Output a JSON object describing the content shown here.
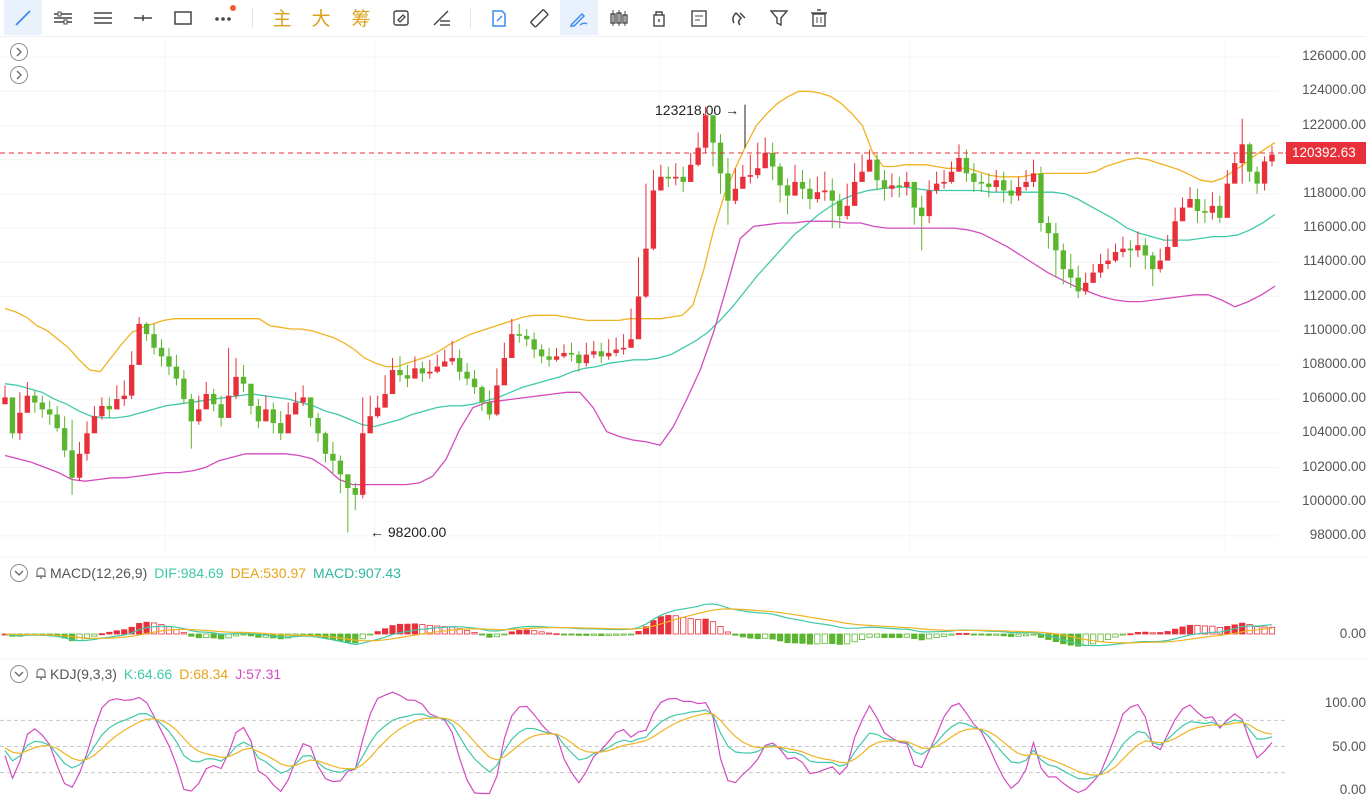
{
  "toolbar": {
    "items": [
      {
        "name": "trend-line-tool",
        "icon": "trend-line-icon",
        "active": true
      },
      {
        "name": "horizontal-ray-tool",
        "icon": "horizontal-ray-icon"
      },
      {
        "name": "parallel-channel-tool",
        "icon": "parallel-lines-icon"
      },
      {
        "name": "horizontal-line-tool",
        "icon": "horizontal-line-icon"
      },
      {
        "name": "rectangle-tool",
        "icon": "rectangle-icon"
      },
      {
        "name": "more-tools",
        "icon": "more-dots-icon"
      }
    ],
    "text_buttons": [
      "主",
      "大",
      "筹"
    ],
    "tools_right": [
      {
        "name": "auto-refresh",
        "icon": "refresh-edit-icon"
      },
      {
        "name": "compare",
        "icon": "compare-icon"
      },
      {
        "name": "copy",
        "icon": "copy-icon"
      },
      {
        "name": "ruler",
        "icon": "ruler-icon"
      },
      {
        "name": "draw",
        "icon": "pen-icon",
        "active": true
      },
      {
        "name": "candles",
        "icon": "candles-icon"
      },
      {
        "name": "lock",
        "icon": "lock-icon"
      },
      {
        "name": "note",
        "icon": "note-icon"
      },
      {
        "name": "magnet",
        "icon": "magnet-icon"
      },
      {
        "name": "filter",
        "icon": "filter-icon"
      },
      {
        "name": "delete",
        "icon": "trash-icon"
      }
    ]
  },
  "colors": {
    "up": "#e8303a",
    "down": "#5bb52f",
    "boll_upper": "#f0b323",
    "boll_mid": "#3fc9a8",
    "boll_lower": "#d44bbf",
    "dif": "#3fc9a8",
    "dea": "#f0b323",
    "k": "#3fc9a8",
    "d": "#f0b323",
    "j": "#d44bbf",
    "price_line": "#e8303a"
  },
  "main_axis": {
    "ticks": [
      "126000.00",
      "124000.00",
      "122000.00",
      "120000.00",
      "118000.00",
      "116000.00",
      "114000.00",
      "112000.00",
      "110000.00",
      "108000.00",
      "106000.00",
      "104000.00",
      "102000.00",
      "100000.00",
      "98000.00"
    ],
    "current_price": "120392.63",
    "current_value": 120392.63
  },
  "annotations": {
    "high": "123218.00 →",
    "low": "← 98200.00"
  },
  "macd": {
    "label": "MACD(12,26,9)",
    "dif": "DIF:984.69",
    "dea": "DEA:530.97",
    "macd": "MACD:907.43",
    "zero_tick": "0.00"
  },
  "kdj": {
    "label": "KDJ(9,3,3)",
    "k": "K:64.66",
    "d": "D:68.34",
    "j": "J:57.31",
    "ticks": [
      "100.00",
      "50.00",
      "0.00"
    ]
  },
  "chart_data": {
    "type": "candlestick",
    "y_range": [
      97000,
      127000
    ],
    "closes": [
      106100,
      104000,
      105200,
      106200,
      105800,
      105400,
      105100,
      104300,
      103000,
      101400,
      102800,
      104000,
      105000,
      105600,
      105400,
      106000,
      106200,
      108000,
      110400,
      109800,
      109000,
      108500,
      107900,
      107200,
      106000,
      104700,
      105400,
      106300,
      105700,
      104900,
      106200,
      107300,
      106900,
      105600,
      104700,
      105400,
      104600,
      104000,
      105100,
      105800,
      106100,
      104900,
      104000,
      102800,
      102400,
      101600,
      100800,
      100400,
      104000,
      105000,
      105500,
      106300,
      107700,
      107400,
      107200,
      107800,
      107500,
      107600,
      107900,
      108200,
      108400,
      107600,
      107200,
      106700,
      105800,
      105100,
      106800,
      108400,
      109800,
      109700,
      109500,
      108900,
      108500,
      108300,
      108500,
      108700,
      108600,
      108100,
      108600,
      108800,
      108500,
      108700,
      108900,
      109000,
      109500,
      112000,
      114800,
      118200,
      119000,
      118900,
      119000,
      118700,
      119700,
      120700,
      122600,
      121000,
      119200,
      117600,
      118300,
      119000,
      119100,
      119500,
      120400,
      119600,
      118500,
      117900,
      118700,
      118300,
      117700,
      118100,
      118200,
      117600,
      116700,
      117300,
      118700,
      119300,
      120000,
      118800,
      118300,
      118500,
      118400,
      118700,
      117200,
      116700,
      118200,
      118600,
      118700,
      119300,
      120100,
      119200,
      118700,
      118600,
      118400,
      118800,
      118200,
      117900,
      118400,
      118700,
      119200,
      116300,
      115700,
      114700,
      113600,
      113100,
      112300,
      112800,
      113400,
      113900,
      114100,
      114600,
      114800,
      114700,
      115000,
      114400,
      113600,
      114100,
      114900,
      116400,
      117200,
      117700,
      117000,
      116900,
      117300,
      116600,
      118600,
      119800,
      120900,
      119300,
      118600,
      119900,
      120300
    ],
    "highs": [
      106800,
      106000,
      106400,
      107000,
      106500,
      106200,
      105900,
      105600,
      105000,
      104800,
      103500,
      104700,
      105600,
      106100,
      106100,
      106800,
      107100,
      108800,
      110800,
      110500,
      110400,
      109500,
      109000,
      108600,
      107700,
      106300,
      106200,
      107000,
      106600,
      106200,
      109000,
      108400,
      108000,
      106700,
      106000,
      106200,
      105800,
      105300,
      105800,
      106400,
      106800,
      106100,
      105200,
      104100,
      103500,
      102700,
      101500,
      101100,
      106100,
      106200,
      106200,
      107400,
      108400,
      108500,
      108000,
      108500,
      108200,
      108300,
      108600,
      108900,
      109400,
      108900,
      108100,
      107700,
      106800,
      106500,
      107800,
      109300,
      110700,
      110400,
      110100,
      109900,
      109200,
      109000,
      109000,
      109200,
      109300,
      108800,
      109300,
      109400,
      109300,
      109500,
      109600,
      109800,
      111300,
      114300,
      118600,
      119400,
      119700,
      119600,
      119800,
      119600,
      120400,
      121600,
      123100,
      122500,
      121500,
      120100,
      119500,
      119700,
      120300,
      121000,
      121300,
      121000,
      119800,
      118900,
      119700,
      119400,
      118900,
      119000,
      119300,
      118900,
      118000,
      118600,
      119800,
      120300,
      120600,
      120300,
      119400,
      119200,
      119000,
      119300,
      118700,
      117900,
      118800,
      119300,
      119400,
      119900,
      120900,
      120600,
      119800,
      119200,
      119200,
      119400,
      119300,
      118800,
      119000,
      119400,
      120000,
      119600,
      116700,
      116300,
      115100,
      114500,
      113800,
      113400,
      113900,
      114500,
      114800,
      115100,
      115500,
      115300,
      115800,
      115400,
      114600,
      114800,
      115600,
      117200,
      117800,
      118400,
      118300,
      117700,
      118100,
      117900,
      119400,
      120400,
      122400,
      121000,
      119600,
      120200,
      120800
    ],
    "lows": [
      105700,
      103700,
      103600,
      105300,
      105200,
      104900,
      104500,
      104100,
      102600,
      100400,
      101200,
      102400,
      104200,
      104800,
      104900,
      105500,
      105600,
      106000,
      108000,
      109400,
      108600,
      107900,
      107400,
      106800,
      105700,
      103100,
      104500,
      105500,
      105300,
      104400,
      105300,
      106000,
      106400,
      105100,
      104300,
      104800,
      104000,
      103600,
      104400,
      105300,
      105600,
      104400,
      103500,
      102300,
      101600,
      100500,
      98200,
      99500,
      100200,
      104400,
      104900,
      105600,
      107200,
      107000,
      106700,
      107300,
      107000,
      107200,
      107500,
      107900,
      108000,
      107100,
      106800,
      106300,
      105300,
      104800,
      105000,
      107900,
      109300,
      109300,
      109100,
      108400,
      108100,
      107900,
      108200,
      108400,
      108200,
      107600,
      107900,
      108400,
      108100,
      108300,
      108500,
      108600,
      109100,
      110900,
      111900,
      114700,
      118400,
      118400,
      118500,
      118100,
      118900,
      119600,
      120400,
      119600,
      118000,
      116200,
      117400,
      118500,
      118600,
      118900,
      119600,
      118800,
      117500,
      116800,
      117900,
      117700,
      117100,
      117500,
      117600,
      116000,
      116000,
      116500,
      117900,
      118800,
      119400,
      118200,
      117600,
      117800,
      117800,
      117900,
      116200,
      114700,
      116300,
      118000,
      118300,
      118600,
      119300,
      118700,
      118100,
      118100,
      117800,
      118100,
      117500,
      117400,
      117600,
      118200,
      118400,
      115800,
      114800,
      113100,
      112700,
      112500,
      111900,
      112100,
      112800,
      113100,
      113600,
      114000,
      114300,
      113700,
      114300,
      113600,
      112600,
      113400,
      114300,
      115600,
      116500,
      117200,
      116300,
      116300,
      116500,
      116300,
      118000,
      119300,
      118600,
      118700,
      118000,
      118200,
      119600
    ],
    "boll_upper": [
      111300,
      111100,
      110800,
      110300,
      110000,
      109500,
      109000,
      108300,
      107700,
      107600,
      108400,
      109200,
      109900,
      110200,
      110400,
      110600,
      110700,
      110700,
      110700,
      110700,
      110700,
      110700,
      110700,
      110700,
      110700,
      110300,
      110200,
      110100,
      110100,
      110000,
      109800,
      109600,
      109300,
      108900,
      108400,
      108100,
      107900,
      107900,
      108100,
      108300,
      108500,
      108800,
      109200,
      109500,
      109800,
      110000,
      110200,
      110400,
      110600,
      110800,
      110900,
      110900,
      110900,
      110800,
      110700,
      110600,
      110600,
      110600,
      110600,
      110700,
      110700,
      110700,
      110700,
      110800,
      110900,
      111500,
      113500,
      116000,
      118000,
      119500,
      120800,
      122000,
      122700,
      123300,
      123700,
      124000,
      124000,
      123900,
      123700,
      123300,
      122700,
      122000,
      120400,
      119600,
      119600,
      119700,
      119700,
      119700,
      119600,
      119500,
      119500,
      119500,
      119300,
      119100,
      119000,
      119000,
      119000,
      119100,
      119200,
      119200,
      119200,
      119200,
      119200,
      119300,
      119600,
      119800,
      120000,
      120100,
      120000,
      119800,
      119600,
      119400,
      119100,
      118800,
      118700,
      118900,
      119300,
      119700,
      120200,
      120600,
      121000
    ],
    "boll_mid": [
      106900,
      106800,
      106600,
      106400,
      106000,
      105700,
      105300,
      105000,
      104900,
      104900,
      105000,
      105200,
      105400,
      105600,
      105700,
      105800,
      105900,
      106000,
      106100,
      106200,
      106300,
      106200,
      106100,
      106000,
      105800,
      105600,
      105300,
      105100,
      104800,
      104500,
      104400,
      104600,
      104800,
      105100,
      105300,
      105500,
      105600,
      105600,
      105700,
      105900,
      106100,
      106400,
      106700,
      106900,
      107100,
      107300,
      107600,
      107800,
      107900,
      108100,
      108200,
      108300,
      108300,
      108400,
      108600,
      109000,
      109400,
      109900,
      110600,
      111400,
      112300,
      113200,
      114000,
      114800,
      115600,
      116200,
      116800,
      117300,
      117700,
      118000,
      118200,
      118300,
      118400,
      118400,
      118300,
      118200,
      118200,
      118200,
      118200,
      118200,
      118100,
      118100,
      118100,
      118100,
      118100,
      118100,
      118000,
      117700,
      117300,
      116900,
      116500,
      116000,
      115700,
      115500,
      115300,
      115300,
      115300,
      115400,
      115500,
      115500,
      115600,
      115900,
      116300,
      116800
    ],
    "boll_lower": [
      102700,
      102500,
      102300,
      102000,
      101700,
      101300,
      101200,
      101300,
      101400,
      101400,
      101500,
      101600,
      101700,
      101700,
      101800,
      102000,
      102400,
      102600,
      102800,
      102800,
      102800,
      102800,
      102700,
      102500,
      102000,
      101300,
      101000,
      101000,
      101000,
      101000,
      101000,
      101100,
      101500,
      102500,
      104200,
      105500,
      105800,
      105900,
      106000,
      106100,
      106200,
      106300,
      106400,
      106400,
      105500,
      104100,
      103800,
      103600,
      103500,
      103300,
      104400,
      106000,
      107700,
      109900,
      112600,
      115400,
      116100,
      116200,
      116300,
      116300,
      116400,
      116400,
      116400,
      116300,
      116300,
      116100,
      116000,
      116000,
      116000,
      116000,
      116000,
      116000,
      115900,
      115700,
      115300,
      114900,
      114400,
      113900,
      113400,
      113000,
      112600,
      112300,
      112000,
      111800,
      111700,
      111700,
      111800,
      111900,
      112000,
      112100,
      112100,
      111800,
      111400,
      111700,
      112100,
      112600
    ]
  }
}
